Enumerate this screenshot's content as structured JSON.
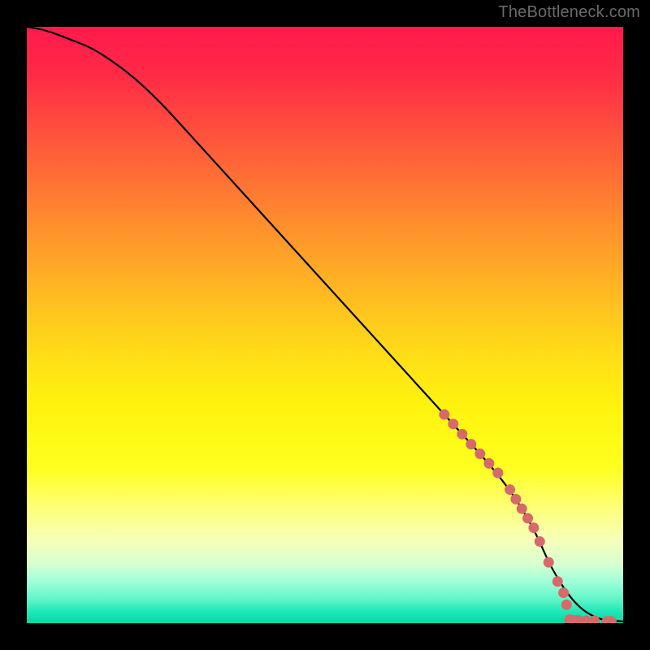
{
  "watermark": "TheBottleneck.com",
  "colors": {
    "frame_bg": "#000000",
    "gradient_top": "#ff1a4d",
    "gradient_mid": "#fff40e",
    "gradient_bottom": "#00daa6",
    "curve": "#000000",
    "markers": "#d66a6a"
  },
  "chart_data": {
    "type": "line",
    "title": "",
    "xlabel": "",
    "ylabel": "",
    "xlim": [
      0,
      100
    ],
    "ylim": [
      0,
      100
    ],
    "grid": false,
    "series": [
      {
        "name": "curve",
        "x": [
          0,
          3,
          7,
          12,
          20,
          30,
          40,
          50,
          60,
          70,
          80,
          85,
          88,
          92,
          96,
          100
        ],
        "y": [
          100,
          99.5,
          98,
          96,
          90,
          79,
          68,
          57,
          46,
          35,
          24,
          16,
          9,
          3,
          0.5,
          0.3
        ]
      }
    ],
    "markers": [
      {
        "x": 70.0,
        "y": 35.0
      },
      {
        "x": 71.5,
        "y": 33.4
      },
      {
        "x": 73.0,
        "y": 31.7
      },
      {
        "x": 74.5,
        "y": 30.0
      },
      {
        "x": 76.0,
        "y": 28.4
      },
      {
        "x": 77.5,
        "y": 26.8
      },
      {
        "x": 79.0,
        "y": 25.2
      },
      {
        "x": 81.0,
        "y": 22.4
      },
      {
        "x": 82.0,
        "y": 20.8
      },
      {
        "x": 83.0,
        "y": 19.2
      },
      {
        "x": 84.0,
        "y": 17.6
      },
      {
        "x": 85.0,
        "y": 16.0
      },
      {
        "x": 86.0,
        "y": 13.7
      },
      {
        "x": 87.5,
        "y": 10.2
      },
      {
        "x": 89.0,
        "y": 7.0
      },
      {
        "x": 90.0,
        "y": 5.1
      },
      {
        "x": 90.5,
        "y": 3.1
      },
      {
        "x": 91.0,
        "y": 0.6
      },
      {
        "x": 91.7,
        "y": 0.5
      },
      {
        "x": 92.4,
        "y": 0.5
      },
      {
        "x": 93.8,
        "y": 0.4
      },
      {
        "x": 95.2,
        "y": 0.4
      },
      {
        "x": 97.3,
        "y": 0.3
      },
      {
        "x": 98.0,
        "y": 0.3
      }
    ]
  }
}
